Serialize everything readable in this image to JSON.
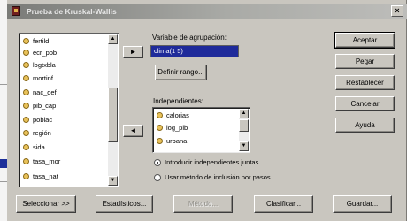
{
  "window": {
    "title": "Prueba de Kruskal-Wallis"
  },
  "variables": {
    "items": [
      "fertild",
      "ecr_pob",
      "logtxbla",
      "mortinf",
      "nac_def",
      "pib_cap",
      "poblac",
      "región",
      "sida",
      "tasa_mor",
      "tasa_nat"
    ]
  },
  "grouping": {
    "label": "Variable de agrupación:",
    "value": "clima(1 5)",
    "define_label": "Definir rango..."
  },
  "independents": {
    "label": "Independientes:",
    "items": [
      "calorias",
      "log_pib",
      "urbana"
    ]
  },
  "options": {
    "radio1": "Introducir independientes juntas",
    "radio2": "Usar método de inclusión por pasos"
  },
  "buttons": {
    "accept": "Aceptar",
    "paste": "Pegar",
    "reset": "Restablecer",
    "cancel": "Cancelar",
    "help": "Ayuda",
    "select": "Seleccionar >>",
    "statistics": "Estadísticos...",
    "method": "Método...",
    "classify": "Clasificar...",
    "save": "Guardar..."
  },
  "arrows": {
    "to_grouping": "►",
    "to_independents": "◄"
  }
}
